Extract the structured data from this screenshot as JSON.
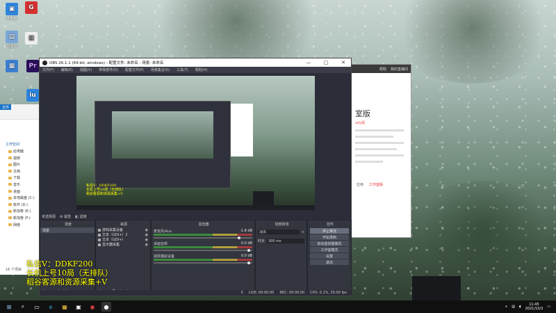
{
  "desktop": {
    "icons": [
      {
        "label": "此电脑",
        "color": "#2e86de",
        "glyph": "▣"
      },
      {
        "label": "回收站",
        "color": "#7aa7d8",
        "glyph": "▤"
      },
      {
        "label": "控制面板",
        "color": "#3b7fd0",
        "glyph": "▦"
      },
      {
        "label": "Pr",
        "color": "#2a0f5a",
        "glyph": "Pr"
      },
      {
        "label": "iu",
        "color": "#2a84e0",
        "glyph": "iu"
      },
      {
        "label": "",
        "color": "#d63031",
        "glyph": "G"
      },
      {
        "label": "",
        "color": "#eee",
        "glyph": "▥"
      }
    ],
    "overlay_lines": [
      "私信V：DDKF200",
      "长机上号10局（无排队）",
      "稻谷客源和资源采集+V"
    ]
  },
  "side_panel": {
    "header_links": [
      "帮助",
      "我的直播间"
    ],
    "title": "室版",
    "subtitle": "ady版",
    "buttons": [
      "应用",
      "工作室版"
    ]
  },
  "explorer": {
    "tab": "文件",
    "section": "工作空间",
    "items": [
      "此电脑",
      "视频",
      "图片",
      "文档",
      "下载",
      "音乐",
      "桌面",
      "本地磁盘 (C:)",
      "软件 (D:)",
      "新加卷 (E:)",
      "新加卷 (F:)",
      "网络"
    ],
    "status": "16 个项目"
  },
  "obs": {
    "title": "OBS 26.1.1 (64-bit, windows) - 配置文件: 未命名 - 场景: 未命名",
    "window_controls": [
      "—",
      "□",
      "✕"
    ],
    "menu": [
      "文件(F)",
      "编辑(E)",
      "视图(V)",
      "停靠部件(D)",
      "配置文件(P)",
      "场景集合(S)",
      "工具(T)",
      "帮助(H)"
    ],
    "preview_overlay": [
      "私信V：DDKF200",
      "长机上号10局（无排队）",
      "稻谷客源和资源采集+V"
    ],
    "source_bar": {
      "label": "未选择源",
      "props": "属性",
      "filters": "滤镜"
    },
    "docks": {
      "scenes": {
        "title": "场景",
        "items": [
          "场景"
        ]
      },
      "sources": {
        "title": "来源",
        "items": [
          "游戏采集设备",
          "文本（GDI+）2",
          "文本（GDI+）",
          "显示器采集"
        ]
      },
      "mixer": {
        "title": "混音器",
        "channels": [
          {
            "name": "麦克风/Aux",
            "db": "-1.8 dB"
          },
          {
            "name": "桌面音频",
            "db": "0.0 dB"
          },
          {
            "name": "视频捕获设备",
            "db": "0.0 dB"
          }
        ]
      },
      "transitions": {
        "title": "场景转场",
        "type": "淡出",
        "duration_label": "时长",
        "duration": "300 ms"
      },
      "controls": {
        "title": "控件",
        "buttons": [
          "停止推流",
          "开始录制",
          "启动虚拟摄像机",
          "工作室模式",
          "设置",
          "退出"
        ]
      }
    },
    "status": {
      "live": "LIVE: 00:00:00",
      "rec": "REC: 00:00:00",
      "cpu": "CPU: 0.1%, 30.00 fps",
      "drop": "0"
    }
  },
  "taskbar": {
    "apps": [
      "⊞",
      "⌕",
      "▭",
      "e",
      "▦",
      "▣",
      "◉",
      "●"
    ],
    "time": "11:45",
    "date": "2021/10/3"
  }
}
